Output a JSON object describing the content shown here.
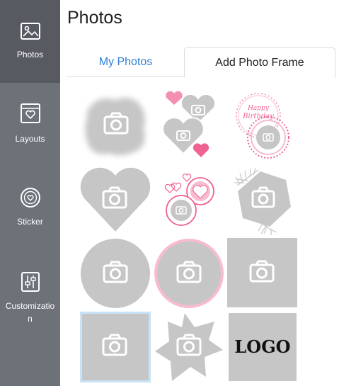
{
  "sidebar": {
    "items": [
      {
        "label": "Photos",
        "icon": "image-icon",
        "active": true
      },
      {
        "label": "Layouts",
        "icon": "layout-heart-icon",
        "active": false
      },
      {
        "label": "Sticker",
        "icon": "sticker-icon",
        "active": false
      },
      {
        "label": "Customization",
        "icon": "sliders-icon",
        "active": false
      }
    ]
  },
  "header": {
    "title": "Photos"
  },
  "tabs": [
    {
      "label": "My Photos",
      "selected": false
    },
    {
      "label": "Add Photo Frame",
      "selected": true
    }
  ],
  "frames": {
    "birthday_line1": "Happy",
    "birthday_line2": "Birthday",
    "logo_text": "LOGO"
  },
  "colors": {
    "sidebar": "#6d7178",
    "sidebar_active": "#575b61",
    "accent_blue": "#2f7fd6",
    "frame_gray": "#c6c6c6",
    "pink": "#f06292"
  }
}
